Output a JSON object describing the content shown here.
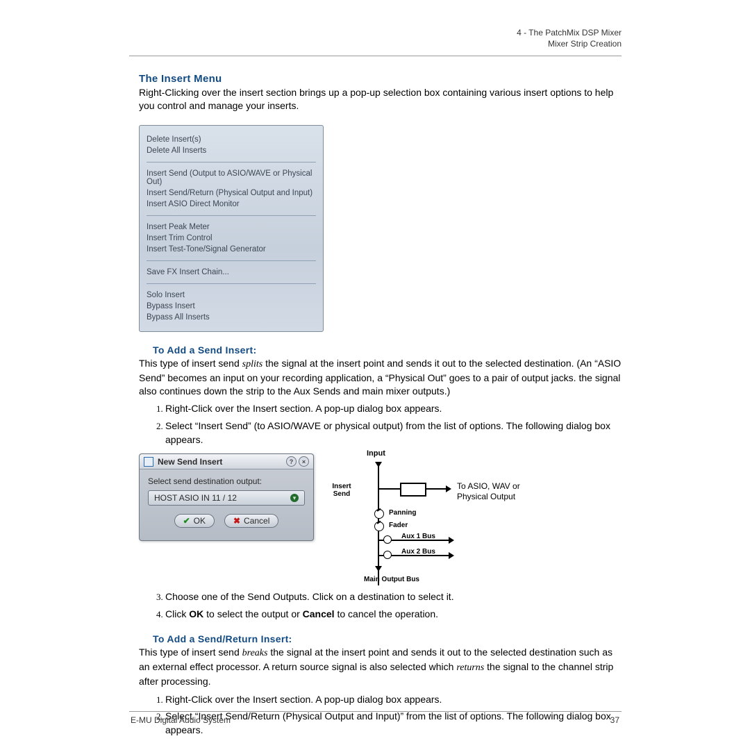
{
  "header": {
    "line1": "4 - The PatchMix DSP Mixer",
    "line2": "Mixer Strip Creation"
  },
  "section1": {
    "title": "The Insert Menu",
    "paragraph": "Right-Clicking over the insert section brings up a pop-up selection box containing various insert options to help you control and manage your inserts."
  },
  "menu": {
    "groups": [
      [
        "Delete Insert(s)",
        "Delete All Inserts"
      ],
      [
        "Insert Send (Output to ASIO/WAVE or Physical Out)",
        "Insert Send/Return (Physical Output and Input)",
        "Insert ASIO Direct Monitor"
      ],
      [
        "Insert Peak Meter",
        "Insert Trim Control",
        "Insert Test-Tone/Signal Generator"
      ],
      [
        "Save FX Insert Chain..."
      ],
      [
        "Solo Insert",
        "Bypass Insert",
        "Bypass All Inserts"
      ]
    ]
  },
  "section2": {
    "title": "To Add a Send Insert:",
    "para_pre": "This type of insert send ",
    "para_em": "splits",
    "para_post": " the signal at the insert point and sends it out to the selected destination. (An “ASIO Send” becomes an input on your recording application, a “Physical Out” goes to a pair of output jacks. the signal also continues down the strip to the Aux Sends and main mixer outputs.)",
    "steps12": [
      "Right-Click over the Insert section. A pop-up dialog box appears.",
      "Select “Insert Send” (to ASIO/WAVE or physical output) from the list of options. The following dialog box appears."
    ],
    "steps34": [
      "Choose one of the Send Outputs. Click on a destination to select it.",
      "Click OK to select the output or Cancel to cancel the operation."
    ],
    "step4_parts": {
      "pre": "Click ",
      "ok": "OK",
      "mid": " to select the output or ",
      "cancel": "Cancel",
      "post": " to cancel the operation."
    }
  },
  "dialog": {
    "title": "New Send Insert",
    "label": "Select send destination output:",
    "value": "HOST ASIO IN 11 / 12",
    "ok": "OK",
    "cancel": "Cancel"
  },
  "diagram": {
    "input": "Input",
    "insert_send": "Insert\nSend",
    "output_text": "To ASIO, WAV or\nPhysical Output",
    "panning": "Panning",
    "fader": "Fader",
    "aux1": "Aux 1 Bus",
    "aux2": "Aux 2 Bus",
    "main": "Main Output Bus"
  },
  "section3": {
    "title": "To Add a Send/Return Insert:",
    "para_pre": "This type of insert send ",
    "para_em1": "breaks",
    "para_mid": " the signal at the insert point and sends it out to the selected destination such as an external effect processor. A return source signal is also selected which ",
    "para_em2": "returns",
    "para_post": " the signal to the channel strip after processing.",
    "steps": [
      "Right-Click over the Insert section. A pop-up dialog box appears.",
      "Select “Insert Send/Return (Physical Output and Input)” from the list of options. The following dialog box appears."
    ]
  },
  "footer": {
    "left": "E-MU Digital Audio System",
    "right": "37"
  }
}
